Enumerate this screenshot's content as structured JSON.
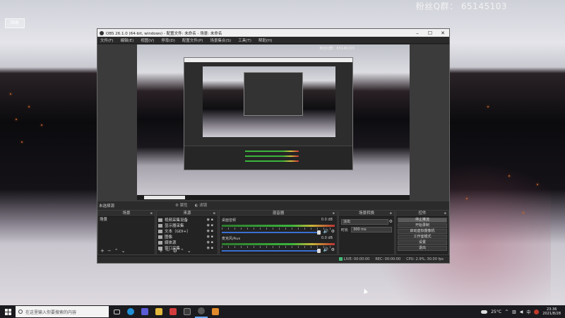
{
  "desktop": {
    "watermark": "粉丝Q群：  65145103",
    "icon_label": "回收"
  },
  "obs": {
    "title": "OBS 26.1.0 (64-bit, windows) - 配置文件: 未命名 - 场景: 未命名",
    "menu": [
      "文件(F)",
      "编辑(E)",
      "视图(V)",
      "停靠(D)",
      "配置文件(P)",
      "场景集合(S)",
      "工具(T)",
      "帮助(H)"
    ],
    "scene_label": "未选择源",
    "scene_props": [
      "属性",
      "滤镜"
    ],
    "preview_watermark": "粉丝Q群：65145103",
    "preview_search": "在这里输入你要搜索的内容",
    "docks": {
      "scenes": {
        "title": "场景",
        "items": [
          "场景"
        ]
      },
      "sources": {
        "title": "来源",
        "items": [
          "视频采集设备",
          "显示器采集",
          "文本（GDI+）",
          "图像",
          "媒体源",
          "窗口采集"
        ]
      },
      "mixer": {
        "title": "混音器",
        "channels": [
          {
            "name": "桌面音频",
            "db": "0.0 dB"
          },
          {
            "name": "麦克风/Aux",
            "db": "0.0 dB"
          }
        ]
      },
      "transitions": {
        "title": "场景转换",
        "selected": "淡出",
        "duration_label": "时长",
        "duration_value": "300 ms"
      },
      "controls": {
        "title": "控件",
        "buttons": [
          "停止推流",
          "开始录制",
          "启动虚拟摄像机",
          "工作室模式",
          "设置",
          "退出"
        ]
      }
    },
    "status": {
      "live": "LIVE: 00:00:00",
      "rec": "REC: 00:00:00",
      "cpu": "CPU: 2.9%, 30.00 fps"
    }
  },
  "taskbar": {
    "search_placeholder": "在这里输入你要搜索的内容",
    "weather": "25°C",
    "time": "23:36",
    "date": "2021/8/28",
    "ime": "中"
  }
}
